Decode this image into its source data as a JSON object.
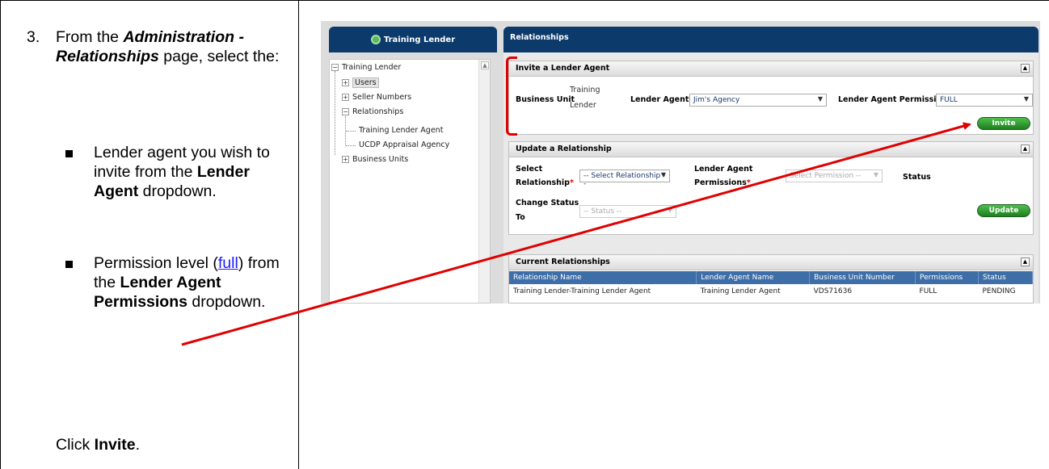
{
  "instructions": {
    "step_number": "3.",
    "intro_prefix": "From the ",
    "intro_bold": "Administration - Relationships",
    "intro_suffix": " page, select the:",
    "bullet1_prefix": "Lender agent you wish to invite from the ",
    "bullet1_bold": "Lender Agent",
    "bullet1_suffix": " dropdown.",
    "bullet2_prefix": "Permission level (",
    "bullet2_link": "full",
    "bullet2_mid": ") from the ",
    "bullet2_bold": "Lender Agent Permissions",
    "bullet2_suffix": " dropdown.",
    "click_prefix": "Click ",
    "click_bold": "Invite",
    "click_suffix": "."
  },
  "app": {
    "left_header": "Training Lender",
    "tree": {
      "root": "Training Lender",
      "users": "Users",
      "seller_numbers": "Seller Numbers",
      "relationships": "Relationships",
      "child1": "Training Lender Agent",
      "child2": "UCDP Appraisal Agency",
      "business_units": "Business Units"
    },
    "right_header": "Relationships",
    "invite": {
      "title": "Invite a Lender Agent",
      "business_unit_label": "Business Unit",
      "business_unit_value_line1": "Training",
      "business_unit_value_line2": "Lender",
      "lender_agent_label": "Lender Agent",
      "lender_agent_value": "Jim's Agency",
      "permissions_label": "Lender Agent Permissions",
      "permissions_value": "FULL",
      "button": "Invite"
    },
    "update": {
      "title": "Update a Relationship",
      "select_label_line1": "Select",
      "select_label_line2": "Relationship",
      "select_value": "-- Select Relationship --",
      "permissions_label_line1": "Lender Agent",
      "permissions_label_line2": "Permissions",
      "permissions_value": "Select Permission --",
      "status_label": "Status",
      "change_label_line1": "Change Status",
      "change_label_line2": "To",
      "change_value": "-- Status --",
      "button": "Update"
    },
    "current": {
      "title": "Current Relationships",
      "columns": [
        "Relationship Name",
        "Lender Agent Name",
        "Business Unit Number",
        "Permissions",
        "Status"
      ],
      "rows": [
        [
          "Training Lender-Training Lender Agent",
          "Training Lender Agent",
          "VDS71636",
          "FULL",
          "PENDING"
        ]
      ]
    }
  },
  "colors": {
    "annotation": "#e00000",
    "header_navy": "#0c3a6b",
    "button_green": "#2e9b2e",
    "table_header_blue": "#3d6ea8"
  }
}
